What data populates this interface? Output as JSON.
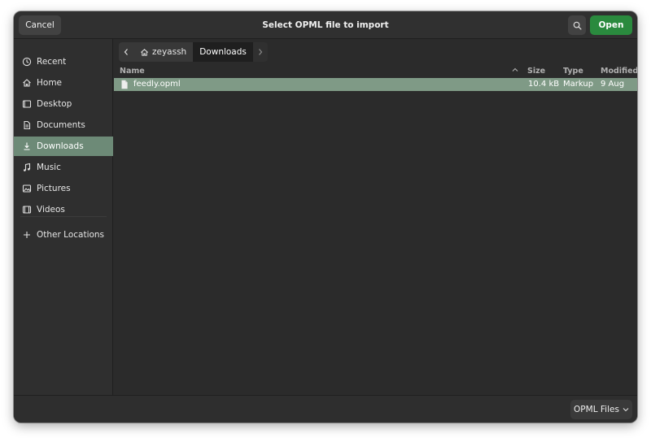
{
  "header": {
    "cancel_label": "Cancel",
    "title": "Select OPML file to import",
    "open_label": "Open",
    "search_icon": "search-icon"
  },
  "sidebar": {
    "items": [
      {
        "label": "Recent",
        "icon": "clock-icon"
      },
      {
        "label": "Home",
        "icon": "home-icon"
      },
      {
        "label": "Desktop",
        "icon": "desktop-icon"
      },
      {
        "label": "Documents",
        "icon": "document-icon"
      },
      {
        "label": "Downloads",
        "icon": "download-icon",
        "active": true
      },
      {
        "label": "Music",
        "icon": "music-icon"
      },
      {
        "label": "Pictures",
        "icon": "picture-icon"
      },
      {
        "label": "Videos",
        "icon": "video-icon"
      },
      {
        "label": "Other Locations",
        "icon": "plus-icon"
      }
    ]
  },
  "pathbar": {
    "segments": [
      {
        "label": "zeyassh",
        "icon": "home-icon"
      },
      {
        "label": "Downloads",
        "current": true
      }
    ]
  },
  "columns": {
    "name": "Name",
    "size": "Size",
    "type": "Type",
    "modified": "Modified"
  },
  "files": [
    {
      "name": "feedly.opml",
      "size": "10.4 kB",
      "type": "Markup",
      "modified": "9 Aug",
      "selected": true
    }
  ],
  "footer": {
    "filter_label": "OPML Files"
  },
  "colors": {
    "accent_open": "#2a8a3e",
    "sidebar_active": "#6d8a77",
    "row_selected": "#7f9a86"
  }
}
